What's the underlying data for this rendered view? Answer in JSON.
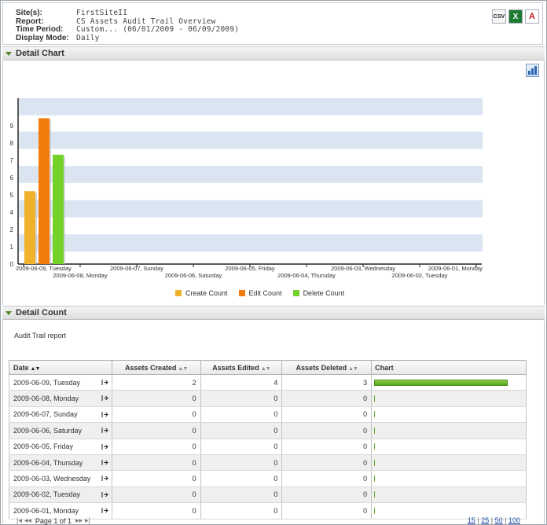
{
  "header": {
    "site_label": "Site(s):",
    "site_value": "FirstSiteII",
    "report_label": "Report:",
    "report_value": "CS Assets Audit Trail Overview",
    "period_label": "Time Period:",
    "period_value": "Custom... (06/01/2009 - 06/09/2009)",
    "mode_label": "Display Mode:",
    "mode_value": "Daily",
    "export": {
      "csv_label": "CSV",
      "excel_label": "X",
      "pdf_label": "A"
    }
  },
  "detail_chart": {
    "section_title": "Detail Chart",
    "legend": [
      {
        "label": "Create Count",
        "color": "#f0b12c"
      },
      {
        "label": "Edit Count",
        "color": "#f27b0c"
      },
      {
        "label": "Delete Count",
        "color": "#74d12a"
      }
    ]
  },
  "chart_data": {
    "type": "bar",
    "categories": [
      "2009-06-09, Tuesday",
      "2009-06-08, Monday",
      "2009-06-07, Sunday",
      "2009-06-06, Saturday",
      "2009-06-05, Friday",
      "2009-06-04, Thursday",
      "2009-06-03, Wednesday",
      "2009-06-02, Tuesday",
      "2009-06-01, Monday"
    ],
    "series": [
      {
        "name": "Create Count",
        "values": [
          4,
          0,
          0,
          0,
          0,
          0,
          0,
          0,
          0
        ],
        "color": "#f0b12c"
      },
      {
        "name": "Edit Count",
        "values": [
          8,
          0,
          0,
          0,
          0,
          0,
          0,
          0,
          0
        ],
        "color": "#f27b0c"
      },
      {
        "name": "Delete Count",
        "values": [
          6,
          0,
          0,
          0,
          0,
          0,
          0,
          0,
          0
        ],
        "color": "#74d12a"
      }
    ],
    "yticks": [
      "0",
      "1",
      "2",
      "4",
      "5",
      "6",
      "7",
      "8",
      "9"
    ],
    "ylim": [
      0,
      9
    ],
    "grid": true,
    "legend_position": "bottom"
  },
  "detail_count": {
    "section_title": "Detail Count",
    "report_label": "Audit Trail report",
    "columns": [
      "Date",
      "Assets Created",
      "Assets Edited",
      "Assets Deleted",
      "Chart"
    ],
    "rows": [
      {
        "date": "2009-06-09, Tuesday",
        "created": "2",
        "edited": "4",
        "deleted": "3",
        "bar": 1.0
      },
      {
        "date": "2009-06-08, Monday",
        "created": "0",
        "edited": "0",
        "deleted": "0",
        "bar": 0
      },
      {
        "date": "2009-06-07, Sunday",
        "created": "0",
        "edited": "0",
        "deleted": "0",
        "bar": 0
      },
      {
        "date": "2009-06-06, Saturday",
        "created": "0",
        "edited": "0",
        "deleted": "0",
        "bar": 0
      },
      {
        "date": "2009-06-05, Friday",
        "created": "0",
        "edited": "0",
        "deleted": "0",
        "bar": 0
      },
      {
        "date": "2009-06-04, Thursday",
        "created": "0",
        "edited": "0",
        "deleted": "0",
        "bar": 0
      },
      {
        "date": "2009-06-03, Wednesday",
        "created": "0",
        "edited": "0",
        "deleted": "0",
        "bar": 0
      },
      {
        "date": "2009-06-02, Tuesday",
        "created": "0",
        "edited": "0",
        "deleted": "0",
        "bar": 0
      },
      {
        "date": "2009-06-01, Monday",
        "created": "0",
        "edited": "0",
        "deleted": "0",
        "bar": 0
      }
    ],
    "pager": {
      "text": "Page 1 of 1"
    },
    "page_sizes": [
      "15",
      "25",
      "50",
      "100"
    ]
  }
}
